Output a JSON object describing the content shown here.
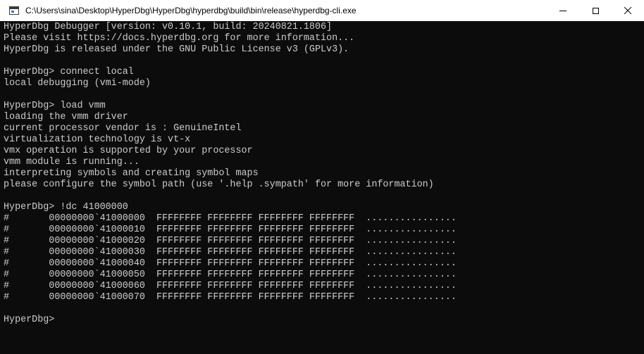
{
  "window": {
    "title": "C:\\Users\\sina\\Desktop\\HyperDbg\\HyperDbg\\hyperdbg\\build\\bin\\release\\hyperdbg-cli.exe",
    "icon": "console-app-icon",
    "controls": [
      "minimize-icon",
      "maximize-icon",
      "close-icon"
    ]
  },
  "colors": {
    "background": "#0c0c0c",
    "text": "#cccccc",
    "titlebar": "#ffffff"
  },
  "console": {
    "lines": [
      "HyperDbg Debugger [version: v0.10.1, build: 20240821.1806]",
      "Please visit https://docs.hyperdbg.org for more information...",
      "HyperDbg is released under the GNU Public License v3 (GPLv3).",
      "",
      "HyperDbg> connect local",
      "local debugging (vmi-mode)",
      "",
      "HyperDbg> load vmm",
      "loading the vmm driver",
      "current processor vendor is : GenuineIntel",
      "virtualization technology is vt-x",
      "vmx operation is supported by your processor",
      "vmm module is running...",
      "interpreting symbols and creating symbol maps",
      "please configure the symbol path (use '.help .sympath' for more information)",
      "",
      "HyperDbg> !dc 41000000",
      "#       00000000`41000000  FFFFFFFF FFFFFFFF FFFFFFFF FFFFFFFF  ................",
      "#       00000000`41000010  FFFFFFFF FFFFFFFF FFFFFFFF FFFFFFFF  ................",
      "#       00000000`41000020  FFFFFFFF FFFFFFFF FFFFFFFF FFFFFFFF  ................",
      "#       00000000`41000030  FFFFFFFF FFFFFFFF FFFFFFFF FFFFFFFF  ................",
      "#       00000000`41000040  FFFFFFFF FFFFFFFF FFFFFFFF FFFFFFFF  ................",
      "#       00000000`41000050  FFFFFFFF FFFFFFFF FFFFFFFF FFFFFFFF  ................",
      "#       00000000`41000060  FFFFFFFF FFFFFFFF FFFFFFFF FFFFFFFF  ................",
      "#       00000000`41000070  FFFFFFFF FFFFFFFF FFFFFFFF FFFFFFFF  ................",
      "",
      "HyperDbg>"
    ]
  }
}
